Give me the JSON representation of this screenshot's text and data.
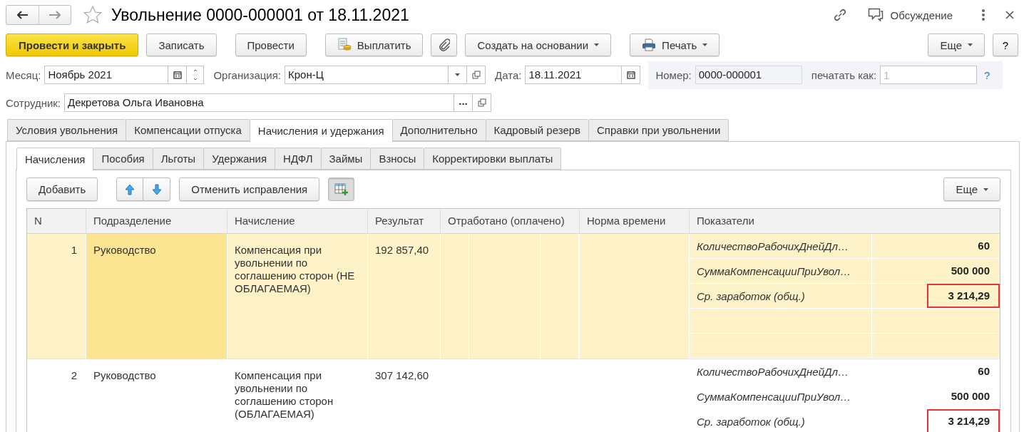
{
  "window": {
    "title": "Увольнение 0000-000001 от 18.11.2021",
    "favorite": false,
    "discussion": "Обсуждение"
  },
  "toolbar": {
    "buttons": [
      {
        "kind": "primary",
        "label": "Провести и закрыть"
      },
      {
        "kind": "plain",
        "label": "Записать"
      },
      {
        "kind": "plain",
        "label": "Провести"
      },
      {
        "kind": "pay",
        "label": "Выплатить"
      },
      {
        "kind": "attach"
      },
      {
        "kind": "dropdown",
        "label": "Создать на основании"
      },
      {
        "kind": "print",
        "label": "Печать"
      }
    ],
    "more": "Еще",
    "help": "?"
  },
  "header": {
    "month": {
      "label": "Месяц:",
      "value": "Ноябрь 2021"
    },
    "organization": {
      "label": "Организация:",
      "value": "Крон-Ц"
    },
    "date": {
      "label": "Дата:",
      "value": "18.11.2021"
    },
    "number": {
      "label": "Номер:",
      "value": "0000-000001"
    },
    "print_as": {
      "label": "печатать как:",
      "placeholder": "1"
    },
    "help": "?",
    "employee": {
      "label": "Сотрудник:",
      "value": "Декретова Ольга Ивановна",
      "select": "..."
    }
  },
  "tabs": [
    {
      "label": "Условия увольнения",
      "selected": false
    },
    {
      "label": "Компенсации отпуска",
      "selected": false
    },
    {
      "label": "Начисления и удержания",
      "selected": true
    },
    {
      "label": "Дополнительно",
      "selected": false
    },
    {
      "label": "Кадровый резерв",
      "selected": false
    },
    {
      "label": "Справки при увольнении",
      "selected": false
    }
  ],
  "subtabs": [
    {
      "label": "Начисления",
      "selected": true
    },
    {
      "label": "Пособия",
      "selected": false
    },
    {
      "label": "Льготы",
      "selected": false
    },
    {
      "label": "Удержания",
      "selected": false
    },
    {
      "label": "НДФЛ",
      "selected": false
    },
    {
      "label": "Займы",
      "selected": false
    },
    {
      "label": "Взносы",
      "selected": false
    },
    {
      "label": "Корректировки выплаты",
      "selected": false
    }
  ],
  "table_toolbar": {
    "add": "Добавить",
    "undo_corrections": "Отменить исправления",
    "grid_pressed": true,
    "more": "Еще"
  },
  "table": {
    "columns": [
      "N",
      "Подразделение",
      "Начисление",
      "Результат",
      "Отработано (оплачено)",
      "Норма времени",
      "Показатели"
    ],
    "rows": [
      {
        "n": "1",
        "department": "Руководство",
        "accrual": "Компенсация при увольнении по соглашению сторон (НЕ ОБЛАГАЕМАЯ)",
        "result": "192 857,40",
        "selected": true,
        "indicators": [
          {
            "name": "КоличествоРабочихДнейДл…",
            "value": "60",
            "highlighted": false
          },
          {
            "name": "СуммаКомпенсацииПриУвол…",
            "value": "500 000",
            "highlighted": false
          },
          {
            "name": "Ср. заработок (общ.)",
            "value": "3 214,29",
            "highlighted": true
          }
        ]
      },
      {
        "n": "2",
        "department": "Руководство",
        "accrual": "Компенсация при увольнении по соглашению сторон (ОБЛАГАЕМАЯ)",
        "result": "307 142,60",
        "selected": false,
        "indicators": [
          {
            "name": "КоличествоРабочихДнейДл…",
            "value": "60",
            "highlighted": false
          },
          {
            "name": "СуммаКомпенсацииПриУвол…",
            "value": "500 000",
            "highlighted": false
          },
          {
            "name": "Ср. заработок (общ.)",
            "value": "3 214,29",
            "highlighted": true
          }
        ]
      }
    ]
  }
}
